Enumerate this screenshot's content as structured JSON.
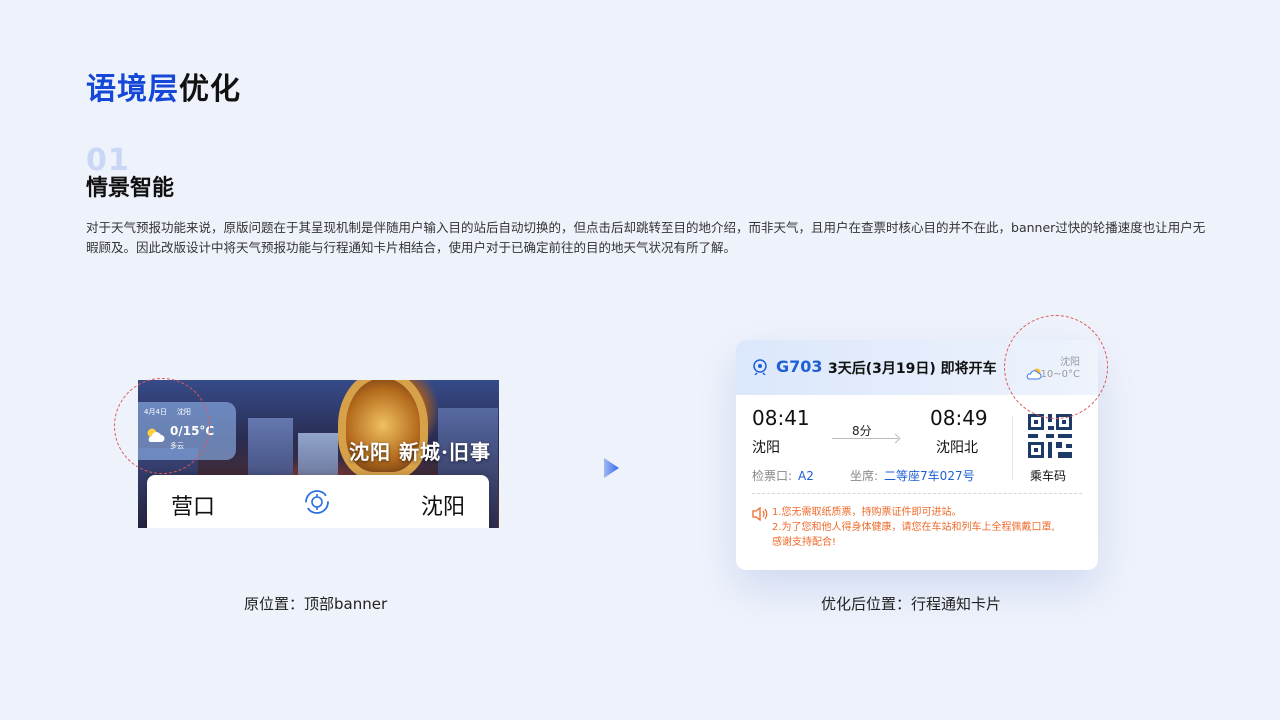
{
  "page": {
    "title_accent": "语境层",
    "title_rest": "优化"
  },
  "section": {
    "number": "01",
    "title": "情景智能",
    "description": "对于天气预报功能来说，原版问题在于其呈现机制是伴随用户输入目的站后自动切换的，但点击后却跳转至目的地介绍，而非天气，且用户在查票时核心目的并不在此，banner过快的轮播速度也让用户无暇顾及。因此改版设计中将天气预报功能与行程通知卡片相结合，使用户对于已确定前往的目的地天气状况有所了解。"
  },
  "banner": {
    "date": "4月4日",
    "city": "沈阳",
    "temp": "0/15°C",
    "condition": "多云",
    "slogan": "沈阳 新城·旧事",
    "from": "营口",
    "to": "沈阳",
    "caption": "原位置：顶部banner"
  },
  "trip": {
    "train_no": "G703",
    "depart_info": "3天后(3月19日) 即将开车",
    "weather_city": "沈阳",
    "weather_temp": "10~0°C",
    "dep_time": "08:41",
    "arr_time": "08:49",
    "dep_station": "沈阳",
    "arr_station": "沈阳北",
    "duration": "8分",
    "gate_label": "检票口:",
    "gate": "A2",
    "seat_label": "坐席:",
    "seat": "二等座7车027号",
    "qr_label": "乘车码",
    "notice_line1": "1.您无需取纸质票，持购票证件即可进站。",
    "notice_line2": "2.为了您和他人得身体健康，请您在车站和列车上全程佩戴口罩,",
    "notice_line3": "感谢支持配合!",
    "caption": "优化后位置：行程通知卡片"
  },
  "colors": {
    "accent_blue": "#1648d8",
    "train_blue": "#1f5fd6",
    "notice_orange": "#ef6a2a",
    "highlight_circle": "#e05757"
  }
}
